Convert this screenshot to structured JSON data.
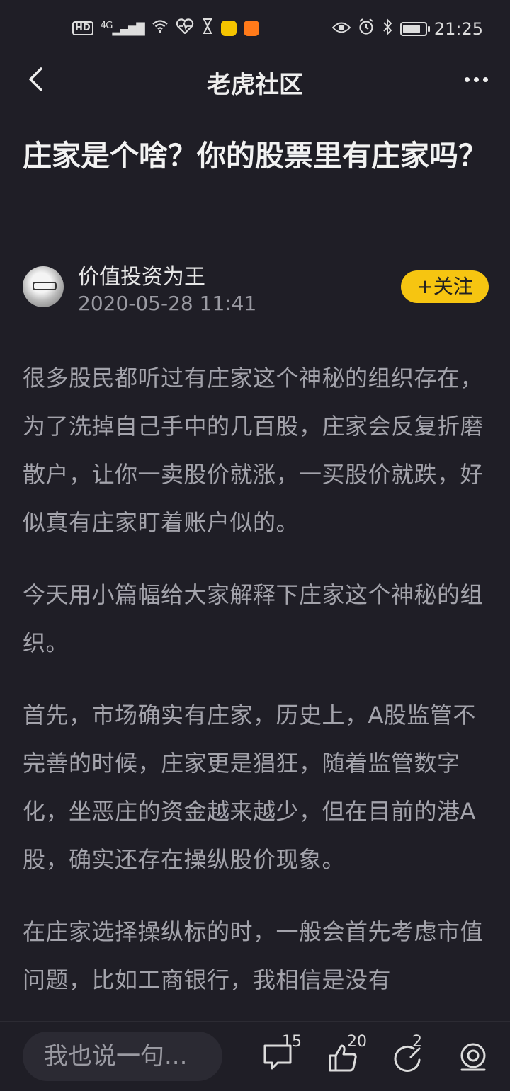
{
  "status_bar": {
    "hd": "HD",
    "network": "4G",
    "time": "21:25",
    "battery_level": 0.85
  },
  "nav": {
    "title": "老虎社区"
  },
  "article": {
    "title": "庄家是个啥？你的股票里有庄家吗？",
    "author": {
      "name": "价值投资为王",
      "date": "2020-05-28 11:41",
      "follow_label": "+关注"
    },
    "paragraphs": [
      "很多股民都听过有庄家这个神秘的组织存在，为了洗掉自己手中的几百股，庄家会反复折磨散户，让你一卖股价就涨，一买股价就跌，好似真有庄家盯着账户似的。",
      "今天用小篇幅给大家解释下庄家这个神秘的组织。",
      "首先，市场确实有庄家，历史上，A股监管不完善的时候，庄家更是猖狂，随着监管数字化，坐恶庄的资金越来越少，但在目前的港A股，确实还存在操纵股价现象。",
      "在庄家选择操纵标的时，一般会首先考虑市值问题，比如工商银行，我相信是没有"
    ]
  },
  "bottom_bar": {
    "comment_placeholder": "我也说一句...",
    "comment_count": "15",
    "like_count": "20",
    "share_count": "2"
  },
  "colors": {
    "background": "#1f1e26",
    "accent": "#f6c511",
    "body_text": "#a3a3ab"
  }
}
